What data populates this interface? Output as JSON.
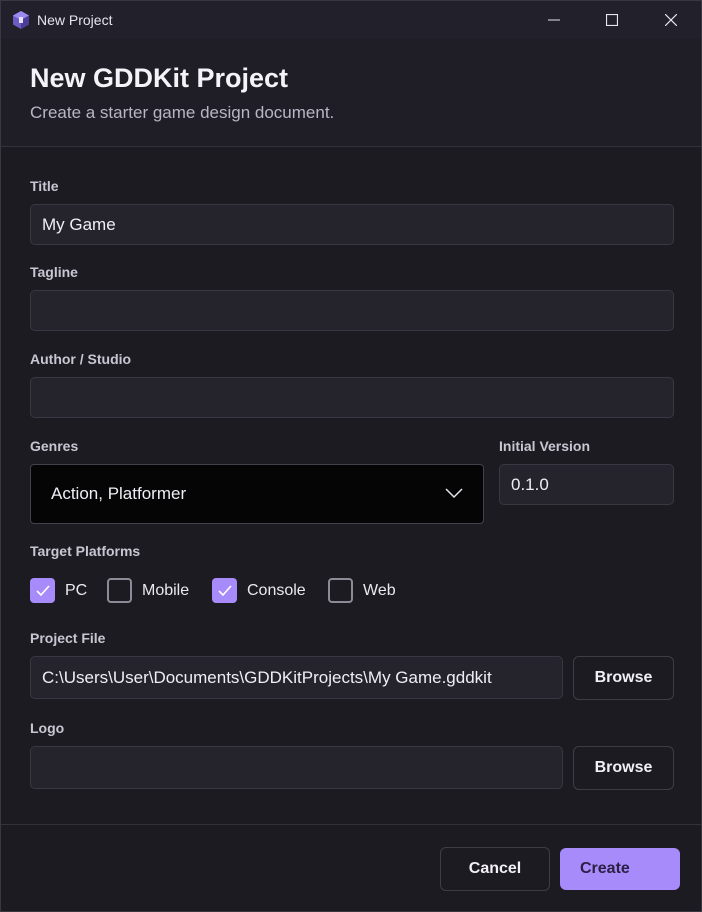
{
  "window": {
    "title": "New Project",
    "icon": "gddkit-logo-icon"
  },
  "header": {
    "title": "New GDDKit Project",
    "subtitle": "Create a starter game design document."
  },
  "form": {
    "title_label": "Title",
    "title_value": "My Game",
    "tagline_label": "Tagline",
    "tagline_value": "",
    "author_label": "Author / Studio",
    "author_value": "",
    "genres_label": "Genres",
    "genres_value": "Action, Platformer",
    "version_label": "Initial Version",
    "version_value": "0.1.0",
    "platforms_label": "Target Platforms",
    "platforms": [
      {
        "label": "PC",
        "checked": true
      },
      {
        "label": "Mobile",
        "checked": false
      },
      {
        "label": "Console",
        "checked": true
      },
      {
        "label": "Web",
        "checked": false
      }
    ],
    "project_file_label": "Project File",
    "project_file_value": "C:\\Users\\User\\Documents\\GDDKitProjects\\My Game.gddkit",
    "logo_label": "Logo",
    "logo_value": "",
    "browse_label": "Browse"
  },
  "footer": {
    "cancel_label": "Cancel",
    "create_label": "Create"
  },
  "colors": {
    "accent": "#a78bfa",
    "background": "#1c1b22"
  }
}
